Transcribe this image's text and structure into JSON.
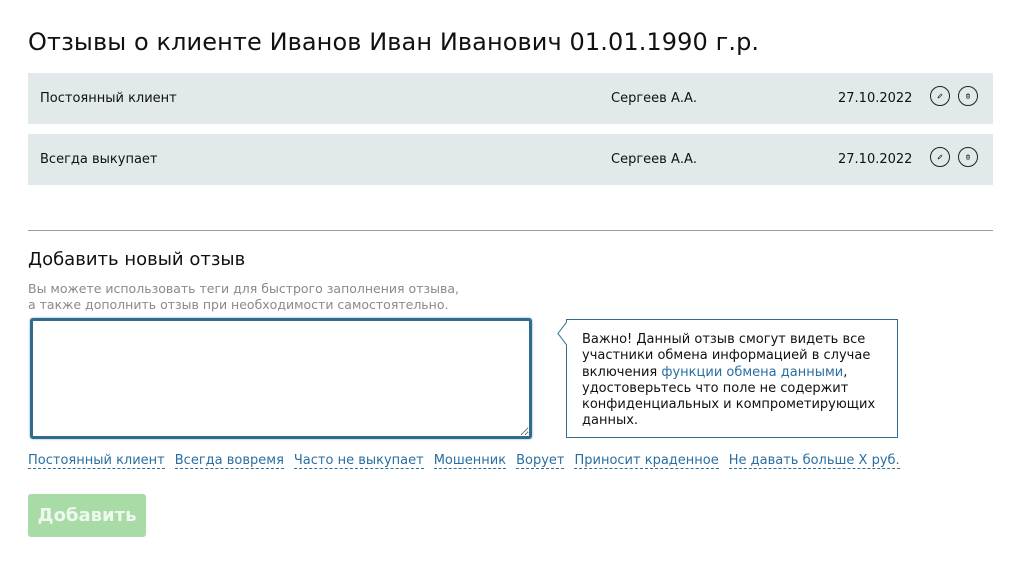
{
  "page": {
    "title": "Отзывы о клиенте Иванов Иван Иванович 01.01.1990 г.р."
  },
  "reviews": [
    {
      "text": "Постоянный клиент",
      "author": "Сергеев А.А.",
      "date": "27.10.2022"
    },
    {
      "text": "Всегда выкупает",
      "author": "Сергеев А.А.",
      "date": "27.10.2022"
    }
  ],
  "icons": {
    "edit": "pencil-icon",
    "delete": "trash-icon"
  },
  "new_review": {
    "title": "Добавить новый отзыв",
    "hint_line1": "Вы можете использовать теги для быстрого заполнения отзыва,",
    "hint_line2": "а также дополнить отзыв при необходимости самостоятельно.",
    "textarea_value": "",
    "notice": {
      "text_before": "Важно! Данный отзыв смогут видеть все участники обмена информацией в случае включения ",
      "link": "функции обмена данными",
      "text_after": ", удостоверьтесь что поле не содержит конфиденциальных и компрометирующих данных."
    },
    "tags": [
      "Постоянный клиент",
      "Всегда вовремя",
      "Часто не выкупает",
      "Мошенник",
      "Ворует",
      "Приносит краденное",
      "Не давать больше Х руб."
    ],
    "submit_label": "Добавить",
    "submit_disabled": true
  },
  "colors": {
    "row_background": "#e1e9ea",
    "link": "#2a6ea0",
    "textarea_border": "#2e6d8e",
    "button_disabled": "#a9dba6"
  }
}
